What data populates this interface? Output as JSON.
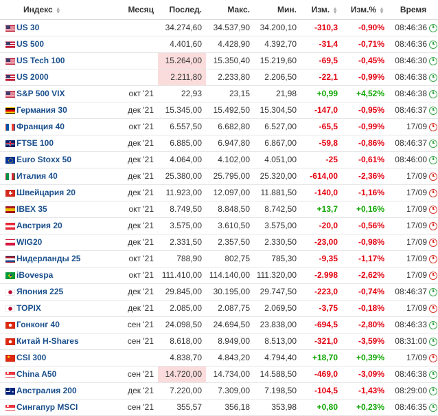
{
  "header": {
    "index": "Индекс",
    "month": "Месяц",
    "last": "Послед.",
    "high": "Макс.",
    "low": "Мин.",
    "chg": "Изм.",
    "chg_pct": "Изм.%",
    "time": "Время"
  },
  "rows": [
    {
      "flag": "us-flag-icon",
      "name": "US 30",
      "month": "",
      "last": "34.274,60",
      "high": "34.537,90",
      "low": "34.200,10",
      "chg": "-310,3",
      "chg_pct": "-0,90%",
      "time": "08:46:36",
      "dir": "neg",
      "status": "open",
      "hl": false
    },
    {
      "flag": "us-flag-icon",
      "name": "US 500",
      "month": "",
      "last": "4.401,60",
      "high": "4.428,90",
      "low": "4.392,70",
      "chg": "-31,4",
      "chg_pct": "-0,71%",
      "time": "08:46:36",
      "dir": "neg",
      "status": "open",
      "hl": false
    },
    {
      "flag": "us-flag-icon",
      "name": "US Tech 100",
      "month": "",
      "last": "15.264,00",
      "high": "15.350,40",
      "low": "15.219,60",
      "chg": "-69,5",
      "chg_pct": "-0,45%",
      "time": "08:46:30",
      "dir": "neg",
      "status": "open",
      "hl": true
    },
    {
      "flag": "us-flag-icon",
      "name": "US 2000",
      "month": "",
      "last": "2.211,80",
      "high": "2.233,80",
      "low": "2.206,50",
      "chg": "-22,1",
      "chg_pct": "-0,99%",
      "time": "08:46:38",
      "dir": "neg",
      "status": "open",
      "hl": true
    },
    {
      "flag": "us-flag-icon",
      "name": "S&P 500 VIX",
      "month": "окт '21",
      "last": "22,93",
      "high": "23,15",
      "low": "21,98",
      "chg": "+0,99",
      "chg_pct": "+4,52%",
      "time": "08:46:38",
      "dir": "pos",
      "status": "open",
      "hl": false
    },
    {
      "flag": "germany-flag-icon",
      "name": "Германия 30",
      "month": "дек '21",
      "last": "15.345,00",
      "high": "15.492,50",
      "low": "15.304,50",
      "chg": "-147,0",
      "chg_pct": "-0,95%",
      "time": "08:46:37",
      "dir": "neg",
      "status": "open",
      "hl": false
    },
    {
      "flag": "france-flag-icon",
      "name": "Франция 40",
      "month": "окт '21",
      "last": "6.557,50",
      "high": "6.682,80",
      "low": "6.527,00",
      "chg": "-65,5",
      "chg_pct": "-0,99%",
      "time": "17/09",
      "dir": "neg",
      "status": "closed",
      "hl": false
    },
    {
      "flag": "uk-flag-icon",
      "name": "FTSE 100",
      "month": "дек '21",
      "last": "6.885,00",
      "high": "6.947,80",
      "low": "6.867,00",
      "chg": "-59,8",
      "chg_pct": "-0,86%",
      "time": "08:46:37",
      "dir": "neg",
      "status": "open",
      "hl": false
    },
    {
      "flag": "eu-flag-icon",
      "name": "Euro Stoxx 50",
      "month": "дек '21",
      "last": "4.064,00",
      "high": "4.102,00",
      "low": "4.051,00",
      "chg": "-25",
      "chg_pct": "-0,61%",
      "time": "08:46:00",
      "dir": "neg",
      "status": "open",
      "hl": false
    },
    {
      "flag": "italy-flag-icon",
      "name": "Италия 40",
      "month": "дек '21",
      "last": "25.380,00",
      "high": "25.795,00",
      "low": "25.320,00",
      "chg": "-614,00",
      "chg_pct": "-2,36%",
      "time": "17/09",
      "dir": "neg",
      "status": "closed",
      "hl": false
    },
    {
      "flag": "switzerland-flag-icon",
      "name": "Швейцария 20",
      "month": "дек '21",
      "last": "11.923,00",
      "high": "12.097,00",
      "low": "11.881,50",
      "chg": "-140,0",
      "chg_pct": "-1,16%",
      "time": "17/09",
      "dir": "neg",
      "status": "closed",
      "hl": false
    },
    {
      "flag": "spain-flag-icon",
      "name": "IBEX 35",
      "month": "окт '21",
      "last": "8.749,50",
      "high": "8.848,50",
      "low": "8.742,50",
      "chg": "+13,7",
      "chg_pct": "+0,16%",
      "time": "17/09",
      "dir": "pos",
      "status": "closed",
      "hl": false
    },
    {
      "flag": "austria-flag-icon",
      "name": "Австрия 20",
      "month": "дек '21",
      "last": "3.575,00",
      "high": "3.610,50",
      "low": "3.575,00",
      "chg": "-20,0",
      "chg_pct": "-0,56%",
      "time": "17/09",
      "dir": "neg",
      "status": "closed",
      "hl": false
    },
    {
      "flag": "poland-flag-icon",
      "name": "WIG20",
      "month": "дек '21",
      "last": "2.331,50",
      "high": "2.357,50",
      "low": "2.330,50",
      "chg": "-23,00",
      "chg_pct": "-0,98%",
      "time": "17/09",
      "dir": "neg",
      "status": "closed",
      "hl": false
    },
    {
      "flag": "netherlands-flag-icon",
      "name": "Нидерланды 25",
      "month": "окт '21",
      "last": "788,90",
      "high": "802,75",
      "low": "785,30",
      "chg": "-9,35",
      "chg_pct": "-1,17%",
      "time": "17/09",
      "dir": "neg",
      "status": "closed",
      "hl": false
    },
    {
      "flag": "brazil-flag-icon",
      "name": "iBovespa",
      "month": "окт '21",
      "last": "111.410,00",
      "high": "114.140,00",
      "low": "111.320,00",
      "chg": "-2.998",
      "chg_pct": "-2,62%",
      "time": "17/09",
      "dir": "neg",
      "status": "closed",
      "hl": false
    },
    {
      "flag": "japan-flag-icon",
      "name": "Япония 225",
      "month": "дек '21",
      "last": "29.845,00",
      "high": "30.195,00",
      "low": "29.747,50",
      "chg": "-223,0",
      "chg_pct": "-0,74%",
      "time": "08:46:37",
      "dir": "neg",
      "status": "open",
      "hl": false
    },
    {
      "flag": "japan-flag-icon",
      "name": "TOPIX",
      "month": "дек '21",
      "last": "2.085,00",
      "high": "2.087,75",
      "low": "2.069,50",
      "chg": "-3,75",
      "chg_pct": "-0,18%",
      "time": "17/09",
      "dir": "neg",
      "status": "closed",
      "hl": false
    },
    {
      "flag": "hongkong-flag-icon",
      "name": "Гонконг 40",
      "month": "сен '21",
      "last": "24.098,50",
      "high": "24.694,50",
      "low": "23.838,00",
      "chg": "-694,5",
      "chg_pct": "-2,80%",
      "time": "08:46:33",
      "dir": "neg",
      "status": "open",
      "hl": false
    },
    {
      "flag": "hongkong-flag-icon",
      "name": "Китай H-Shares",
      "month": "сен '21",
      "last": "8.618,00",
      "high": "8.949,00",
      "low": "8.513,00",
      "chg": "-321,0",
      "chg_pct": "-3,59%",
      "time": "08:31:00",
      "dir": "neg",
      "status": "open",
      "hl": false
    },
    {
      "flag": "china-flag-icon",
      "name": "CSI 300",
      "month": "",
      "last": "4.838,70",
      "high": "4.843,20",
      "low": "4.794,40",
      "chg": "+18,70",
      "chg_pct": "+0,39%",
      "time": "17/09",
      "dir": "pos",
      "status": "closed",
      "hl": false
    },
    {
      "flag": "singapore-flag-icon",
      "name": "China A50",
      "month": "сен '21",
      "last": "14.720,00",
      "high": "14.734,00",
      "low": "14.588,50",
      "chg": "-469,0",
      "chg_pct": "-3,09%",
      "time": "08:46:38",
      "dir": "neg",
      "status": "open",
      "hl": true
    },
    {
      "flag": "australia-flag-icon",
      "name": "Австралия 200",
      "month": "дек '21",
      "last": "7.220,00",
      "high": "7.309,00",
      "low": "7.198,50",
      "chg": "-104,5",
      "chg_pct": "-1,43%",
      "time": "08:29:00",
      "dir": "neg",
      "status": "open",
      "hl": false
    },
    {
      "flag": "singapore-flag-icon",
      "name": "Сингапур MSCI",
      "month": "сен '21",
      "last": "355,57",
      "high": "356,18",
      "low": "353,98",
      "chg": "+0,80",
      "chg_pct": "+0,23%",
      "time": "08:46:35",
      "dir": "pos",
      "status": "open",
      "hl": false
    }
  ]
}
